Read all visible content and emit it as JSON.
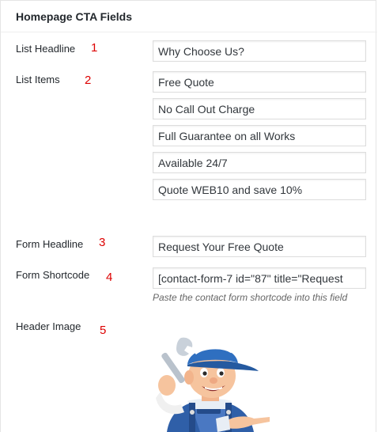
{
  "panel": {
    "title": "Homepage CTA Fields"
  },
  "fields": [
    {
      "label": "List Headline",
      "number": "1",
      "value": "Why Choose Us?"
    },
    {
      "label": "List Items",
      "number": "2",
      "values": [
        "Free Quote",
        "No Call Out Charge",
        "Full Guarantee on all Works",
        "Available 24/7",
        "Quote WEB10 and save 10%"
      ]
    },
    {
      "label": "Form Headline",
      "number": "3",
      "value": "Request Your Free Quote"
    },
    {
      "label": "Form Shortcode",
      "number": "4",
      "value": "[contact-form-7 id=\"87\" title=\"Request",
      "description": "Paste the contact form shortcode into this field"
    },
    {
      "label": "Header Image",
      "number": "5"
    }
  ],
  "colors": {
    "number": "#dd0000",
    "title": "#23282d",
    "border": "#dddddd"
  },
  "icons": {
    "toggle": "caret-up-icon",
    "image": "plumber-mascot-image"
  }
}
